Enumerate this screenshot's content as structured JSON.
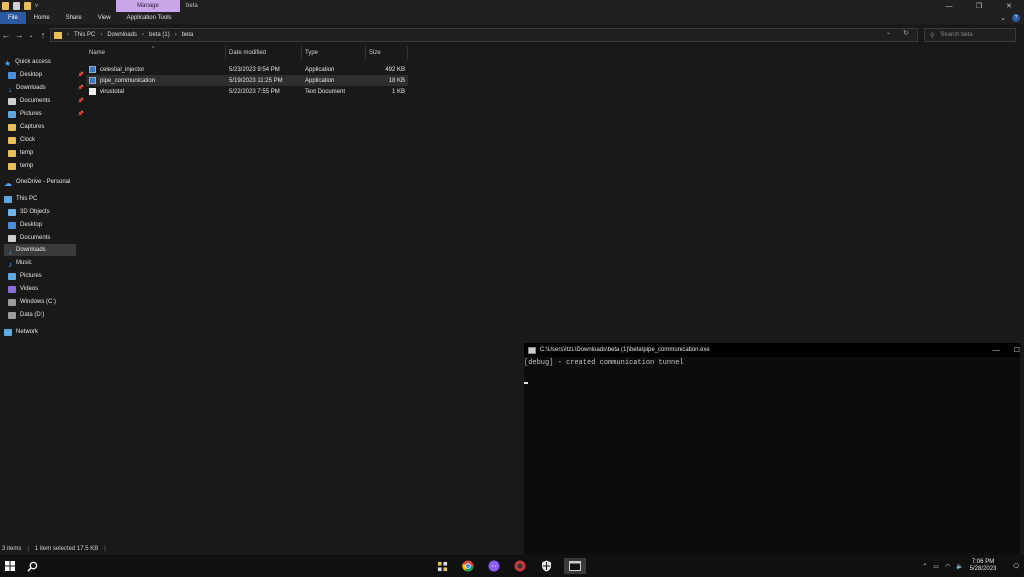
{
  "titlebar": {
    "context_tab": "Manage",
    "window_title": "beta",
    "qat_caret": "v",
    "minimize": "—",
    "maximize": "❐",
    "close": "✕"
  },
  "ribbon": {
    "tabs": [
      "File",
      "Home",
      "Share",
      "View",
      "Application Tools"
    ]
  },
  "address": {
    "parts": [
      "This PC",
      "Downloads",
      "beta (1)",
      "beta"
    ],
    "search_placeholder": "Search beta"
  },
  "navpane": {
    "quick_access": "Quick access",
    "quick_items": [
      "Desktop",
      "Downloads",
      "Documents",
      "Pictures",
      "Captures",
      "Clock",
      "temp",
      "temp"
    ],
    "onedrive": "OneDrive - Personal",
    "this_pc": "This PC",
    "pc_items": [
      "3D Objects",
      "Desktop",
      "Documents",
      "Downloads",
      "Music",
      "Pictures",
      "Videos",
      "Windows (C:)",
      "Data (D:)"
    ],
    "network": "Network"
  },
  "columns": [
    "Name",
    "Date modified",
    "Type",
    "Size"
  ],
  "files": [
    {
      "name": "celestial_injector",
      "date": "5/23/2023 9:54 PM",
      "type": "Application",
      "size": "492 KB"
    },
    {
      "name": "pipe_communication",
      "date": "5/19/2023 11:25 PM",
      "type": "Application",
      "size": "18 KB"
    },
    {
      "name": "virustotal",
      "date": "5/22/2023 7:55 PM",
      "type": "Text Document",
      "size": "1 KB"
    }
  ],
  "statusbar": {
    "count": "3 items",
    "selected": "1 item selected  17.5 KB"
  },
  "console": {
    "title": "C:\\Users\\ItzL\\Downloads\\beta (1)\\beta\\pipe_communication.exe",
    "line": "[debug] - created communication tunnel",
    "minimize": "—",
    "maximize": "☐"
  },
  "taskbar": {
    "time": "7:06 PM",
    "date": "5/28/2023"
  },
  "colors": {
    "accent_file_tab": "#2b5aa0",
    "context_manage": "#c9a7e8",
    "folder": "#e8c05a",
    "background": "#191919"
  }
}
